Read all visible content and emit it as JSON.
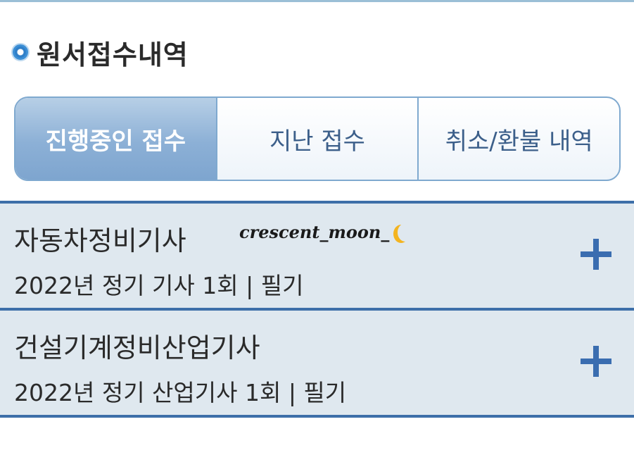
{
  "section": {
    "title": "원서접수내역"
  },
  "tabs": [
    {
      "label": "진행중인 접수",
      "active": true
    },
    {
      "label": "지난 접수",
      "active": false
    },
    {
      "label": "취소/환불 내역",
      "active": false
    }
  ],
  "applications": [
    {
      "title": "자동차정비기사",
      "subtitle": "2022년 정기 기사 1회 | 필기"
    },
    {
      "title": "건설기계정비산업기사",
      "subtitle": "2022년 정기 산업기사 1회 | 필기"
    }
  ],
  "watermark": {
    "text": "crescent_moon_"
  },
  "colors": {
    "accent": "#3a6db0",
    "tab_active": "#8cb0d6",
    "row_bg": "#dfe8ef"
  },
  "icons": {
    "bullet": "circle-bullet-icon",
    "expand": "plus-icon",
    "moon": "crescent-moon-icon"
  }
}
